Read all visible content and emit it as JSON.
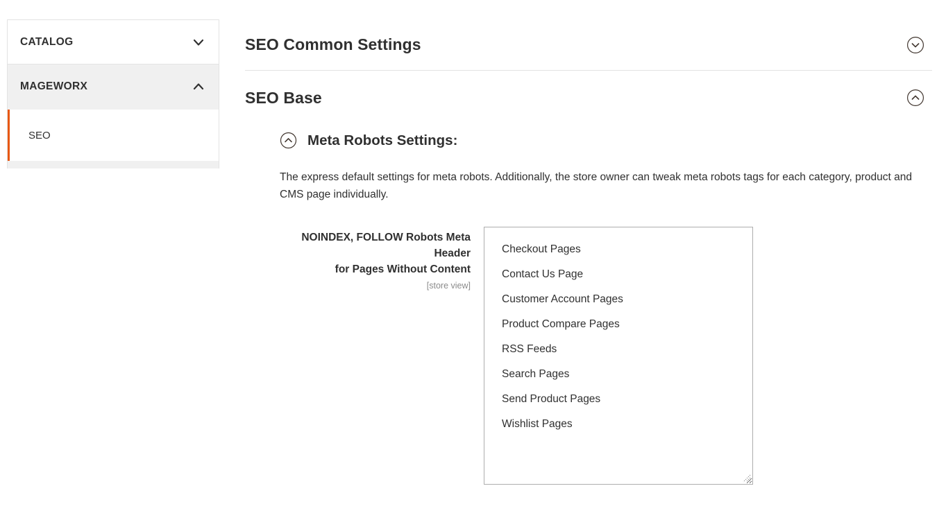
{
  "sidebar": {
    "sections": [
      {
        "label": "CATALOG",
        "icon": "chevron-down-icon",
        "state": "collapsed"
      },
      {
        "label": "MAGEWORX",
        "icon": "chevron-up-icon",
        "state": "expanded"
      }
    ],
    "active_item": {
      "label": "SEO"
    },
    "accent_color": "#e85713"
  },
  "content": {
    "sections": [
      {
        "title": "SEO Common Settings",
        "icon": "circle-chevron-down-icon",
        "state": "collapsed"
      },
      {
        "title": "SEO Base",
        "icon": "circle-chevron-up-icon",
        "state": "expanded"
      }
    ],
    "fieldset": {
      "legend": "Meta Robots Settings:",
      "legend_icon": "circle-chevron-up-icon",
      "comment": "The express default settings for meta robots. Additionally, the store owner can tweak meta robots tags for each category, product and CMS page individually.",
      "field": {
        "label_line_1": "NOINDEX, FOLLOW Robots Meta",
        "label_line_2": "Header",
        "label_line_3": "for Pages Without Content",
        "scope": "[store view]",
        "control_type": "multiselect",
        "options": [
          {
            "label": "Checkout Pages",
            "selected": false
          },
          {
            "label": "Contact Us Page",
            "selected": false
          },
          {
            "label": "Customer Account Pages",
            "selected": false
          },
          {
            "label": "Product Compare Pages",
            "selected": false
          },
          {
            "label": "RSS Feeds",
            "selected": false
          },
          {
            "label": "Search Pages",
            "selected": false
          },
          {
            "label": "Send Product Pages",
            "selected": false
          },
          {
            "label": "Wishlist Pages",
            "selected": false
          }
        ]
      }
    }
  }
}
